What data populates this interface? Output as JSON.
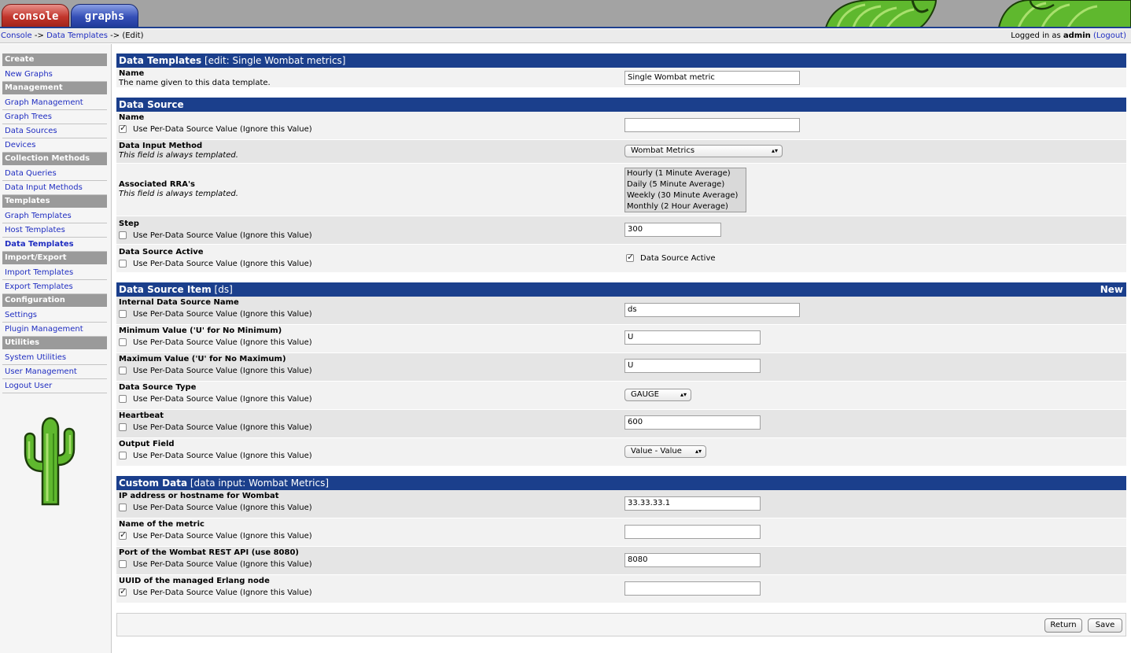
{
  "tabs": [
    {
      "label": "console"
    },
    {
      "label": "graphs"
    }
  ],
  "breadcrumb": {
    "console": "Console",
    "sep1": " -> ",
    "data_templates": "Data Templates",
    "sep2": " -> ",
    "current": "(Edit)"
  },
  "login": {
    "prefix": "Logged in as ",
    "user": "admin",
    "logout": "(Logout)"
  },
  "menu": {
    "create": "Create",
    "new_graphs": "New Graphs",
    "management": "Management",
    "graph_management": "Graph Management",
    "graph_trees": "Graph Trees",
    "data_sources": "Data Sources",
    "devices": "Devices",
    "collection_methods": "Collection Methods",
    "data_queries": "Data Queries",
    "data_input_methods": "Data Input Methods",
    "templates": "Templates",
    "graph_templates": "Graph Templates",
    "host_templates": "Host Templates",
    "data_templates": "Data Templates",
    "import_export": "Import/Export",
    "import_templates": "Import Templates",
    "export_templates": "Export Templates",
    "configuration": "Configuration",
    "settings": "Settings",
    "plugin_management": "Plugin Management",
    "utilities": "Utilities",
    "system_utilities": "System Utilities",
    "user_management": "User Management",
    "logout_user": "Logout User"
  },
  "common": {
    "per_ds": "Use Per-Data Source Value (Ignore this Value)",
    "always_templated": "This field is always templated."
  },
  "s1": {
    "title": "Data Templates",
    "title_suffix": " [edit: Single Wombat metrics]",
    "name_label": "Name",
    "name_desc": "The name given to this data template.",
    "name_value": "Single Wombat metric"
  },
  "s2": {
    "title": "Data Source",
    "name_label": "Name",
    "name_value": "",
    "dim_label": "Data Input Method",
    "dim_value": "Wombat Metrics",
    "rra_label": "Associated RRA's",
    "rra_options": [
      "Hourly (1 Minute Average)",
      "Daily (5 Minute Average)",
      "Weekly (30 Minute Average)",
      "Monthly (2 Hour Average)"
    ],
    "step_label": "Step",
    "step_value": "300",
    "active_label": "Data Source Active",
    "active_check_label": "Data Source Active"
  },
  "s3": {
    "title": "Data Source Item",
    "title_suffix": " [ds]",
    "new": "New",
    "ids_label": "Internal Data Source Name",
    "ids_value": "ds",
    "min_label": "Minimum Value ('U' for No Minimum)",
    "min_value": "U",
    "max_label": "Maximum Value ('U' for No Maximum)",
    "max_value": "U",
    "type_label": "Data Source Type",
    "type_value": "GAUGE",
    "hb_label": "Heartbeat",
    "hb_value": "600",
    "of_label": "Output Field",
    "of_value": "Value - Value"
  },
  "s4": {
    "title": "Custom Data",
    "title_suffix": " [data input: Wombat Metrics]",
    "ip_label": "IP address or hostname for Wombat",
    "ip_value": "33.33.33.1",
    "metric_label": "Name of the metric",
    "metric_value": "",
    "port_label": "Port of the Wombat REST API (use 8080)",
    "port_value": "8080",
    "uuid_label": "UUID of the managed Erlang node",
    "uuid_value": ""
  },
  "buttons": {
    "return": "Return",
    "save": "Save"
  }
}
